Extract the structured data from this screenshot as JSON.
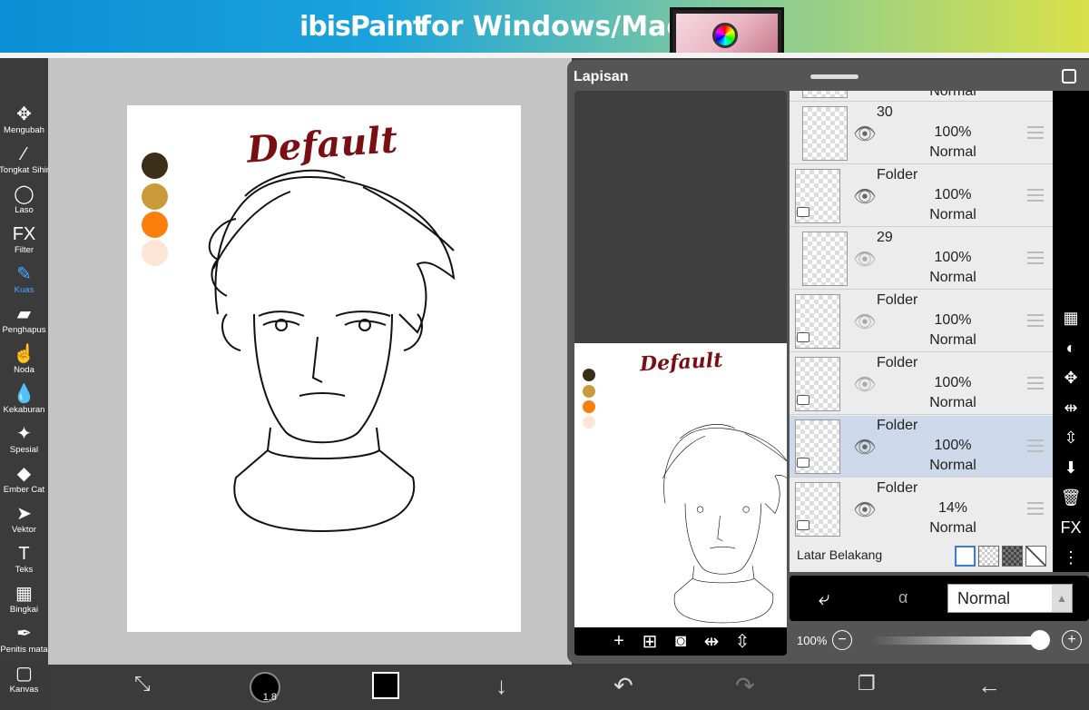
{
  "banner": {
    "brand": "ibisPaint",
    "tagline": "for Windows/Mac"
  },
  "toolbar": [
    {
      "label": "Mengubah",
      "icon": "move-icon",
      "glyph": "✥"
    },
    {
      "label": "Tongkat Sihir",
      "icon": "magic-wand-icon",
      "glyph": "⁄"
    },
    {
      "label": "Laso",
      "icon": "lasso-icon",
      "glyph": "◯"
    },
    {
      "label": "Filter",
      "icon": "fx-icon",
      "glyph": "FX"
    },
    {
      "label": "Kuas",
      "icon": "brush-icon",
      "glyph": "✎",
      "active": true
    },
    {
      "label": "Penghapus",
      "icon": "eraser-icon",
      "glyph": "▰"
    },
    {
      "label": "Noda",
      "icon": "smudge-icon",
      "glyph": "☝"
    },
    {
      "label": "Kekaburan",
      "icon": "blur-icon",
      "glyph": "💧"
    },
    {
      "label": "Spesial",
      "icon": "special-icon",
      "glyph": "✦"
    },
    {
      "label": "Ember Cat",
      "icon": "paint-bucket-icon",
      "glyph": "◆"
    },
    {
      "label": "Vektor",
      "icon": "vector-icon",
      "glyph": "➤"
    },
    {
      "label": "Teks",
      "icon": "text-icon",
      "glyph": "T"
    },
    {
      "label": "Bingkai",
      "icon": "frame-icon",
      "glyph": "▦"
    },
    {
      "label": "Penitis mata",
      "icon": "eyedropper-icon",
      "glyph": "✒"
    },
    {
      "label": "Kanvas",
      "icon": "canvas-icon",
      "glyph": "▢"
    }
  ],
  "canvas": {
    "title": "Default",
    "swatches": [
      "#3b2f1a",
      "#c99a3a",
      "#fb7f0a",
      "#fde6d6"
    ]
  },
  "panel": {
    "title": "Lapisan",
    "preview_title": "Default",
    "preview_buttons": [
      {
        "icon": "add-layer-icon",
        "glyph": "+"
      },
      {
        "icon": "add-folder-icon",
        "glyph": "⊞"
      },
      {
        "icon": "camera-icon",
        "glyph": "◙"
      },
      {
        "icon": "flip-horizontal-icon",
        "glyph": "⇹"
      },
      {
        "icon": "flip-vertical-icon",
        "glyph": "⇳"
      }
    ],
    "layers": [
      {
        "name": "30",
        "opacity": "100%",
        "blend": "Normal",
        "visible": true,
        "folder": false,
        "selected": false
      },
      {
        "name": "Folder",
        "opacity": "100%",
        "blend": "Normal",
        "visible": true,
        "folder": true,
        "selected": false
      },
      {
        "name": "29",
        "opacity": "100%",
        "blend": "Normal",
        "visible": false,
        "folder": false,
        "selected": false
      },
      {
        "name": "Folder",
        "opacity": "100%",
        "blend": "Normal",
        "visible": false,
        "folder": true,
        "selected": false
      },
      {
        "name": "Folder",
        "opacity": "100%",
        "blend": "Normal",
        "visible": false,
        "folder": true,
        "selected": false
      },
      {
        "name": "Folder",
        "opacity": "100%",
        "blend": "Normal",
        "visible": true,
        "folder": true,
        "selected": true
      },
      {
        "name": "Folder",
        "opacity": "14%",
        "blend": "Normal",
        "visible": true,
        "folder": true,
        "selected": false
      }
    ],
    "top_partial_blend": "Normal",
    "background_label": "Latar Belakang",
    "right_icons": [
      {
        "icon": "checker-icon",
        "glyph": "▦"
      },
      {
        "icon": "clipping-circle-icon",
        "glyph": "◐"
      },
      {
        "icon": "move-layer-icon",
        "glyph": "✥"
      },
      {
        "icon": "flip-icon",
        "glyph": "⇹"
      },
      {
        "icon": "merge-down-icon",
        "glyph": "⇳"
      },
      {
        "icon": "download-icon",
        "glyph": "⬇"
      },
      {
        "icon": "trash-icon",
        "glyph": "🗑"
      },
      {
        "icon": "fx-icon",
        "glyph": "FX"
      },
      {
        "icon": "more-icon",
        "glyph": "⋮"
      }
    ],
    "blend_mode": "Normal",
    "opacity_value": "100%",
    "opacity_level": 1.0
  },
  "bottombar": {
    "brush_size": "1.8",
    "color": "#000000"
  }
}
